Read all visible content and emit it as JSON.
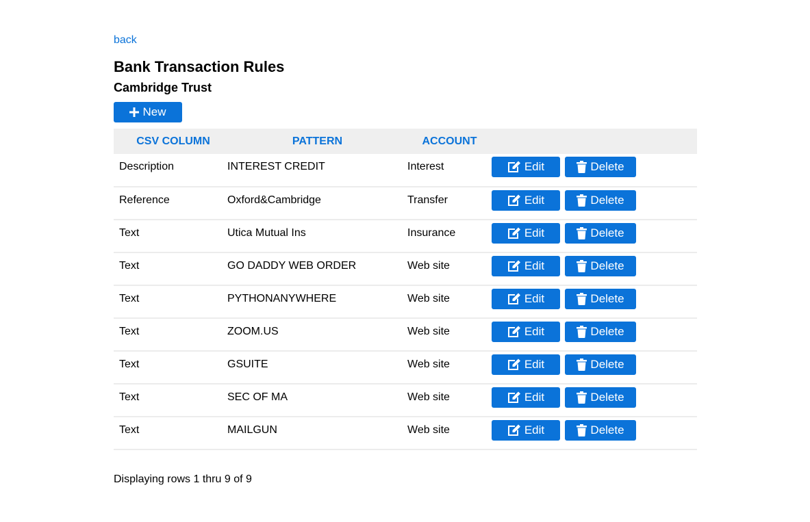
{
  "nav": {
    "back_label": "back"
  },
  "header": {
    "title": "Bank Transaction Rules",
    "subtitle": "Cambridge Trust"
  },
  "toolbar": {
    "new_label": "New"
  },
  "table": {
    "columns": [
      "CSV COLUMN",
      "PATTERN",
      "ACCOUNT"
    ],
    "edit_label": "Edit",
    "delete_label": "Delete",
    "rows": [
      {
        "csv_column": "Description",
        "pattern": "INTEREST CREDIT",
        "account": "Interest"
      },
      {
        "csv_column": "Reference",
        "pattern": "Oxford&Cambridge",
        "account": "Transfer"
      },
      {
        "csv_column": "Text",
        "pattern": "Utica Mutual Ins",
        "account": "Insurance"
      },
      {
        "csv_column": "Text",
        "pattern": "GO DADDY WEB ORDER",
        "account": "Web site"
      },
      {
        "csv_column": "Text",
        "pattern": "PYTHONANYWHERE",
        "account": "Web site"
      },
      {
        "csv_column": "Text",
        "pattern": "ZOOM.US",
        "account": "Web site"
      },
      {
        "csv_column": "Text",
        "pattern": "GSUITE",
        "account": "Web site"
      },
      {
        "csv_column": "Text",
        "pattern": "SEC OF MA",
        "account": "Web site"
      },
      {
        "csv_column": "Text",
        "pattern": "MAILGUN",
        "account": "Web site"
      }
    ]
  },
  "footer": {
    "status": "Displaying rows 1 thru 9 of 9"
  },
  "icons": {
    "new": "plus-icon",
    "edit": "edit-icon",
    "delete": "trash-icon"
  },
  "colors": {
    "accent": "#0b73d9",
    "header_bg": "#efefef",
    "row_border": "#ececec"
  }
}
